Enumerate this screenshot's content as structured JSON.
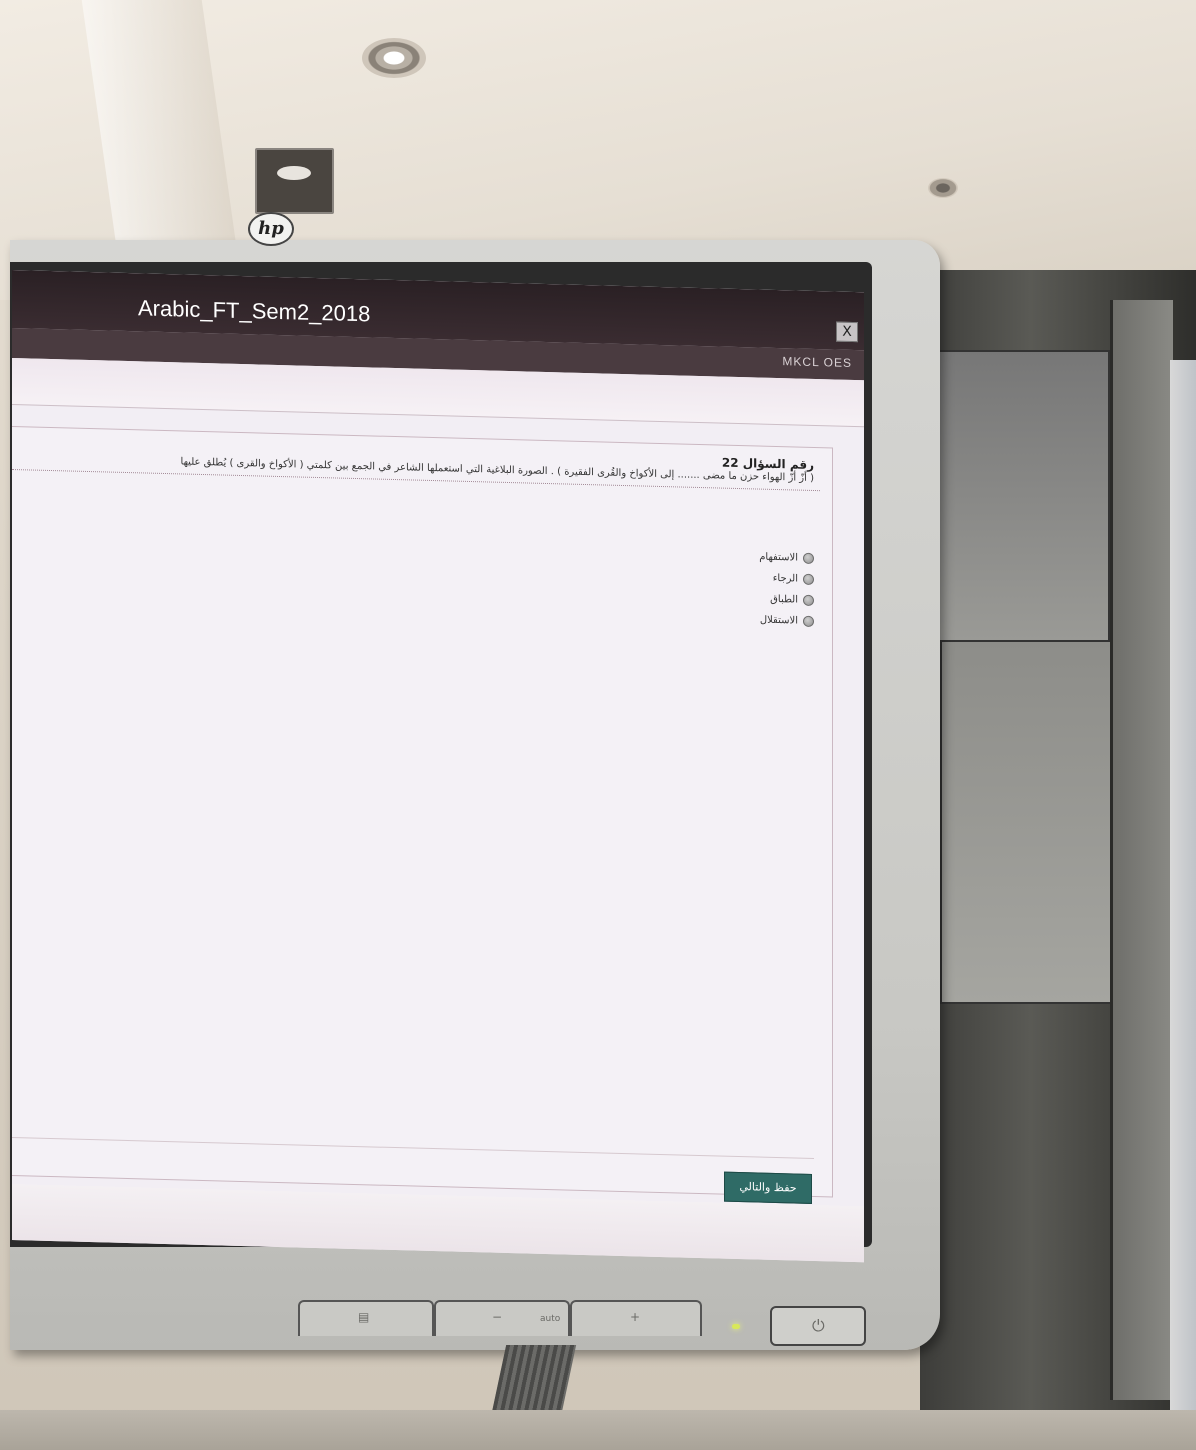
{
  "brand_logo": "hp",
  "window": {
    "title": "Arabic_FT_Sem2_2018",
    "close_label": "X",
    "org_label": "MKCL OES"
  },
  "question": {
    "number_label": "رقم السؤال 22",
    "text": "( أزّ أزّ الهواء حزن ما مضى ....... إلى الأكواخ والقُرى الفقيرة ) . الصورة البلاغية التي استعملها الشاعر في الجمع بين كلمتي ( الأكواخ والقرى ) يُطلق عليها",
    "options": [
      {
        "label": "الاستفهام"
      },
      {
        "label": "الرجاء"
      },
      {
        "label": "الطباق"
      },
      {
        "label": "الاستقلال"
      }
    ]
  },
  "actions": {
    "save_next_label": "حفظ والتالي"
  },
  "colors": {
    "titlebar": "#2a2024",
    "button": "#2f6b66",
    "screen_bg": "#f2eef4"
  },
  "monitor_buttons": {
    "auto_label": "auto"
  }
}
